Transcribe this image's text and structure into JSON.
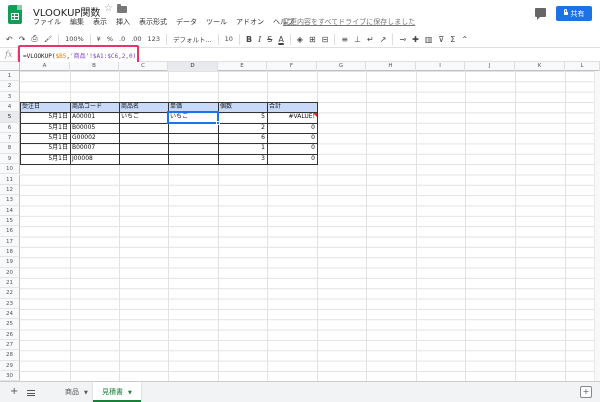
{
  "document": {
    "title": "VLOOKUP関数",
    "save_status": "変更内容をすべてドライブに保存しました",
    "share_label": "共有"
  },
  "menu": [
    "ファイル",
    "編集",
    "表示",
    "挿入",
    "表示形式",
    "データ",
    "ツール",
    "アドオン",
    "ヘルプ"
  ],
  "toolbar": {
    "undo": "↶",
    "redo": "↷",
    "print": "⎙",
    "paint": "🖌",
    "zoom": "100%",
    "currency": "¥",
    "percent": "%",
    "dec_less": ".0",
    "dec_more": ".00",
    "format_more": "123",
    "font": "デフォルト...",
    "font_size": "10",
    "bold": "B",
    "italic": "I",
    "strike": "S",
    "text_color": "A",
    "fill": "◈",
    "borders": "⊞",
    "merge": "⊟",
    "halign": "≡",
    "valign": "⊥",
    "wrap": "↵",
    "rotate": "↗",
    "link": "⊸",
    "comment": "✚",
    "chart": "▥",
    "filter": "⊽",
    "functions": "Σ",
    "collapse": "⌃"
  },
  "formula_bar": {
    "fx": "fx",
    "part_func": "=VLOOKUP(",
    "part_ref1": "$B5",
    "part_sep": ",",
    "part_ref2": "商品'!$A1:$C6,2,0)",
    "part_quote": "'"
  },
  "columns": [
    "A",
    "B",
    "C",
    "D",
    "E",
    "F",
    "G",
    "H",
    "I",
    "J",
    "K",
    "L"
  ],
  "rows": [
    "1",
    "2",
    "3",
    "4",
    "5",
    "6",
    "7",
    "8",
    "9",
    "10",
    "11",
    "12",
    "13",
    "14",
    "15",
    "16",
    "17",
    "18",
    "19",
    "20",
    "21",
    "22",
    "23",
    "24",
    "25",
    "26",
    "27",
    "28",
    "29",
    "30"
  ],
  "table": {
    "headers": [
      "受注日",
      "商品コード",
      "商品名",
      "単価",
      "個数",
      "合計"
    ],
    "rows": [
      [
        "5月1日",
        "A00001",
        "いちご",
        "いちご",
        "5",
        "#VALUE!"
      ],
      [
        "5月1日",
        "B00005",
        "",
        "",
        "2",
        "0"
      ],
      [
        "5月1日",
        "G00002",
        "",
        "",
        "6",
        "0"
      ],
      [
        "5月1日",
        "B00007",
        "",
        "",
        "1",
        "0"
      ],
      [
        "5月1日",
        "J00008",
        "",
        "",
        "3",
        "0"
      ]
    ]
  },
  "sheets": [
    {
      "name": "商品",
      "active": false
    },
    {
      "name": "見積書",
      "active": true
    }
  ],
  "colors": {
    "accent": "#1a73e8",
    "header_fill": "#c9daf8",
    "formula_highlight": "#e8336d",
    "active_tab": "#188038"
  }
}
